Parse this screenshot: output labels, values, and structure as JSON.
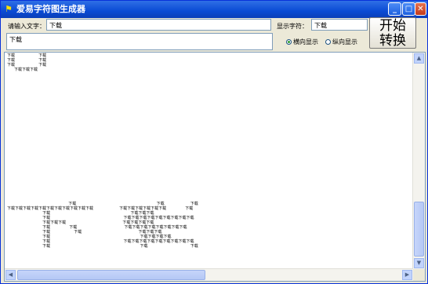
{
  "window": {
    "title": "爱易字符图生成器",
    "app_icon": "app-icon",
    "controls": [
      "minimize-icon",
      "maximize-icon",
      "close-icon"
    ]
  },
  "form": {
    "input_label": "请输入文字：",
    "input_value": "下载",
    "display_char_label": "显示字符：",
    "display_char_value": "下载",
    "multiline_value": "下载",
    "radio_horizontal": "横向显示",
    "radio_vertical": "纵向显示",
    "radio_selected": "横向显示",
    "start_button_line1": "开始",
    "start_button_line2": "转换"
  },
  "output": {
    "art_top": "下载          下载\n下载          下载\n下载          下载\n   下载下载下载",
    "art_bottom": "                          下载                                  下载           下载\n下载下载下载下载下载下载下载下载下载下载下载           下载下载下载下载下载下载        下载\n               下载                                  下载下载下载\n               下载                               下载下载下载下载下载下载下载下载下载\n               下载下载下载                        下载下载下载下载\n               下载        下载                    下载下载下载下载下载下载下载下载\n               下载          下载                        下载下载下载\n               下载                                      下载下载下载下载\n               下载                               下载下载下载下载下载下载下载下载下载\n               下载                                      下载                  下载"
  }
}
